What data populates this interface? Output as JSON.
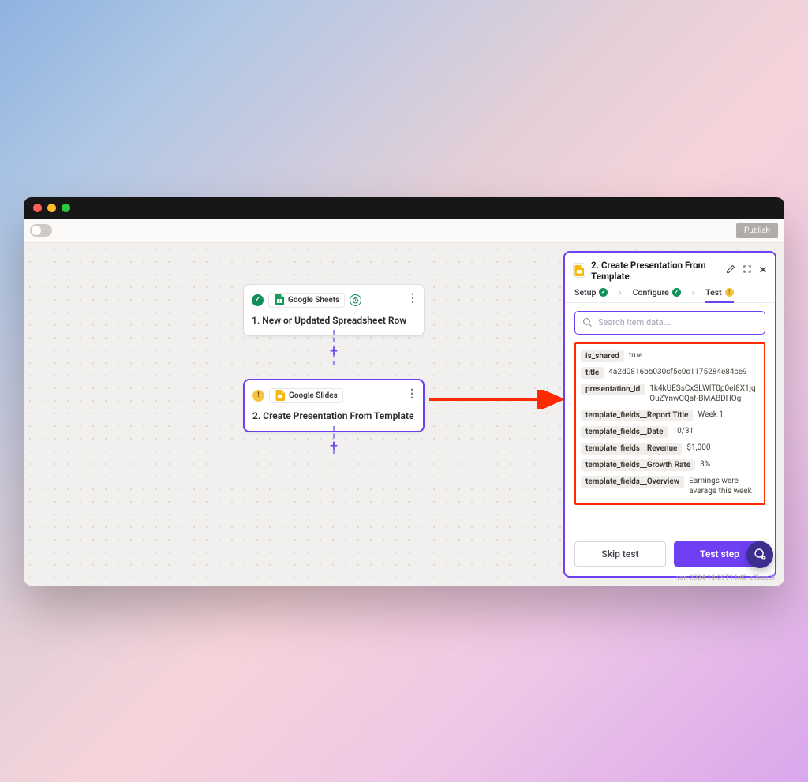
{
  "window": {
    "publish_label": "Publish"
  },
  "steps": {
    "s1": {
      "app_name": "Google Sheets",
      "title": "1. New or Updated Spreadsheet Row"
    },
    "s2": {
      "app_name": "Google Slides",
      "title": "2. Create Presentation From Template"
    }
  },
  "panel": {
    "title_prefix": "2.",
    "title": "Create Presentation From Template",
    "tabs": {
      "setup": "Setup",
      "configure": "Configure",
      "test": "Test"
    },
    "search_placeholder": "Search item data...",
    "results": [
      {
        "key": "is_shared",
        "value": "true"
      },
      {
        "key": "title",
        "value": "4a2d0816bb030cf5c0c1175284e84ce9"
      },
      {
        "key": "presentation_id",
        "value": "1k4kUESsCxSLWlT0p0eI8X1jqOuZYnwCQsf-BMABDHOg"
      },
      {
        "key": "template_fields__Report Title",
        "value": "Week 1"
      },
      {
        "key": "template_fields__Date",
        "value": "10/31"
      },
      {
        "key": "template_fields__Revenue",
        "value": "$1,000"
      },
      {
        "key": "template_fields__Growth Rate",
        "value": "3%"
      },
      {
        "key": "template_fields__Overview",
        "value": "Earnings were average this week"
      }
    ],
    "skip_label": "Skip test",
    "test_label": "Test step"
  },
  "footer": {
    "version": "ver. 2024-10-29T14:42-a9bee9f"
  }
}
